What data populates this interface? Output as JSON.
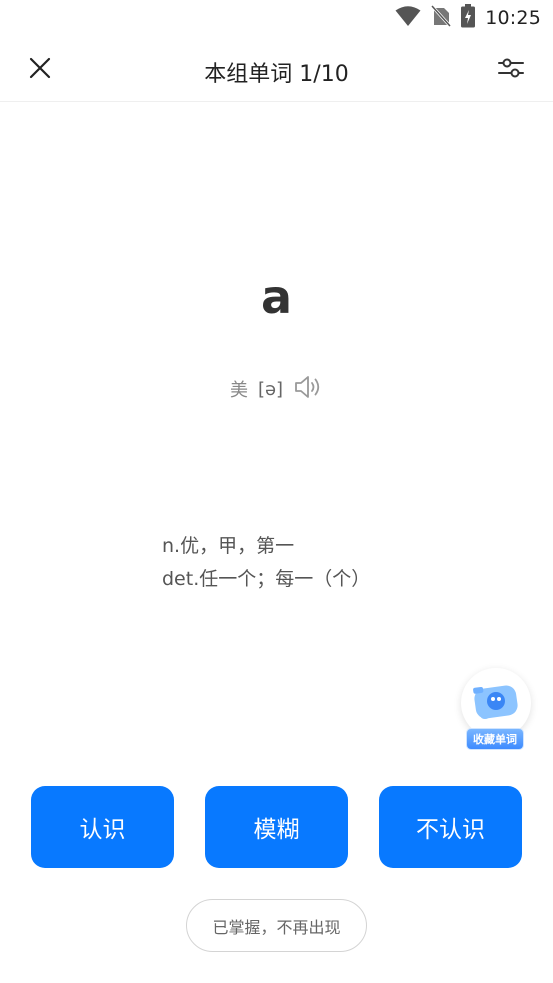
{
  "status_bar": {
    "time": "10:25",
    "icons": [
      "wifi-icon",
      "no-sim-icon",
      "battery-charging-icon"
    ]
  },
  "header": {
    "title": "本组单词 1/10",
    "close_icon": "close-icon",
    "settings_icon": "sliders-icon"
  },
  "word": {
    "text": "a",
    "phonetic_region": "美",
    "phonetic": "[ə]",
    "speaker_icon": "speaker-icon"
  },
  "definitions": [
    "n.优，甲，第一",
    "det.任一个；每一（个）"
  ],
  "favorite": {
    "label": "收藏单词",
    "icon": "favorite-mascot-icon"
  },
  "actions": {
    "know": "认识",
    "vague": "模糊",
    "unknown": "不认识",
    "mastered": "已掌握，不再出现"
  },
  "colors": {
    "accent": "#0879ff",
    "text_primary": "#333333",
    "text_secondary": "#888888"
  }
}
